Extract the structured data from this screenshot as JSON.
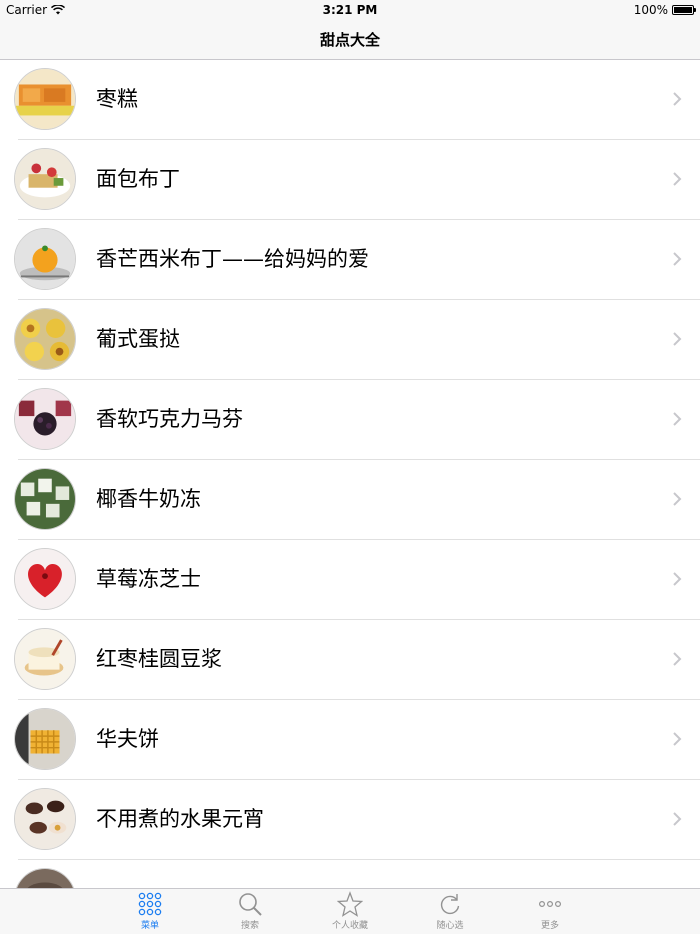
{
  "status_bar": {
    "carrier": "Carrier",
    "time": "3:21 PM",
    "battery": "100%"
  },
  "nav": {
    "title": "甜点大全"
  },
  "list": {
    "items": [
      {
        "label": "枣糕"
      },
      {
        "label": "面包布丁"
      },
      {
        "label": "香芒西米布丁——给妈妈的爱"
      },
      {
        "label": "葡式蛋挞"
      },
      {
        "label": "香软巧克力马芬"
      },
      {
        "label": "椰香牛奶冻"
      },
      {
        "label": "草莓冻芝士"
      },
      {
        "label": "红枣桂圆豆浆"
      },
      {
        "label": "华夫饼"
      },
      {
        "label": "不用煮的水果元宵"
      }
    ]
  },
  "tab_bar": {
    "active_color": "#1a7cf0",
    "inactive_color": "#929292",
    "tabs": [
      {
        "label": "菜单",
        "icon": "grid-dots-icon",
        "active": true
      },
      {
        "label": "搜索",
        "icon": "search-icon",
        "active": false
      },
      {
        "label": "个人收藏",
        "icon": "star-icon",
        "active": false
      },
      {
        "label": "随心选",
        "icon": "refresh-icon",
        "active": false
      },
      {
        "label": "更多",
        "icon": "more-icon",
        "active": false
      }
    ]
  }
}
